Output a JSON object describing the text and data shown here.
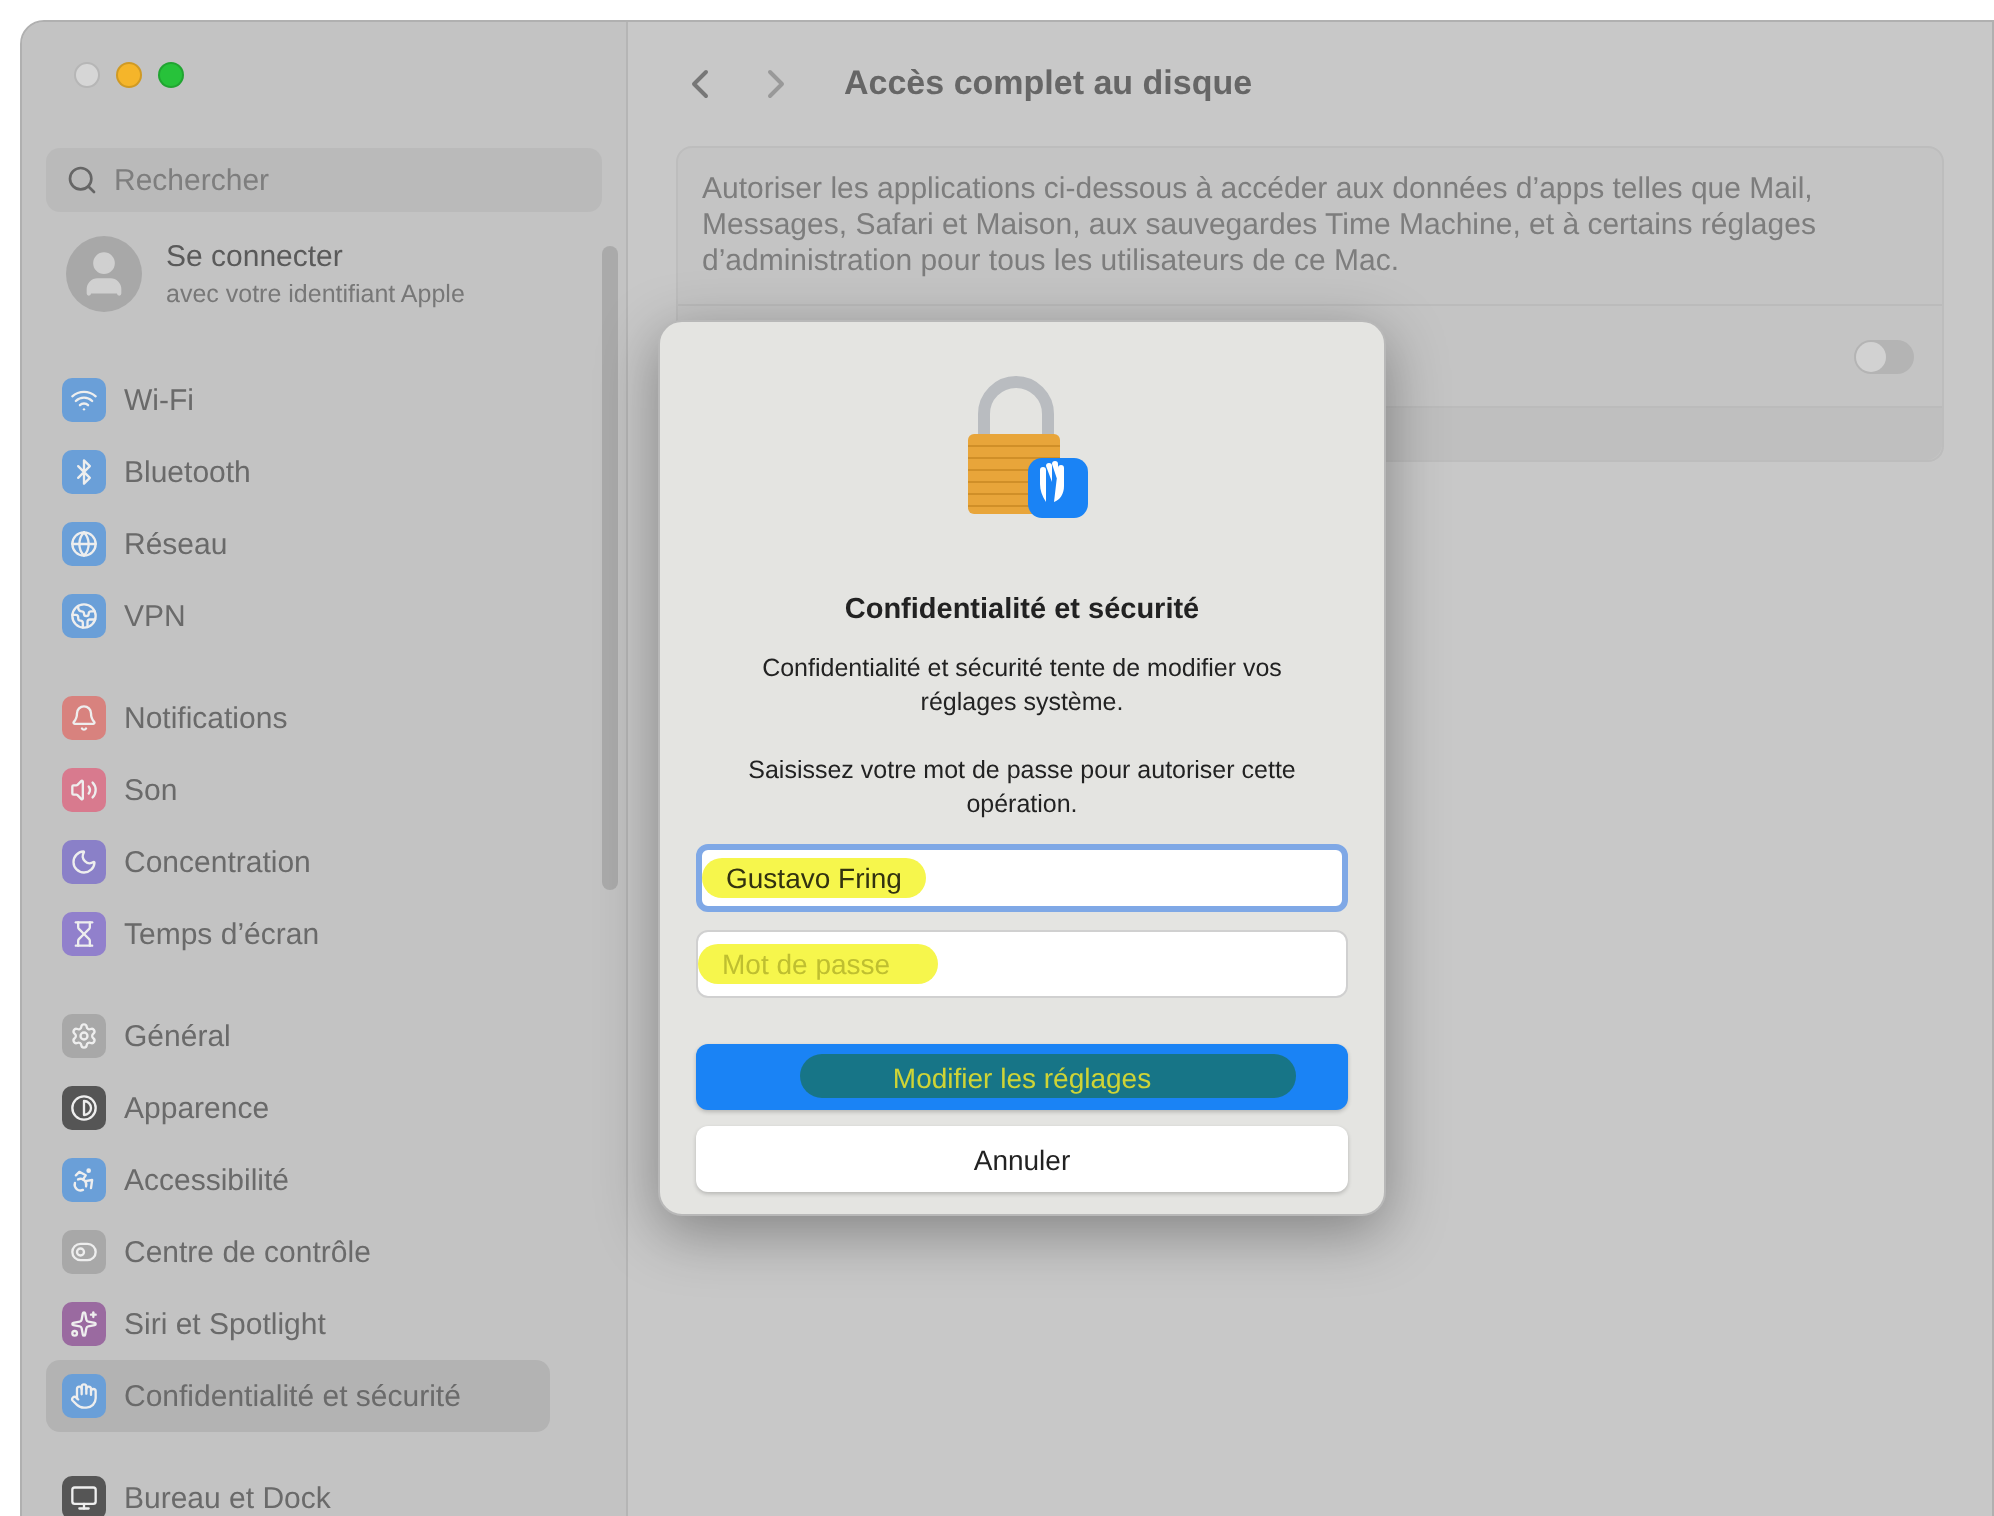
{
  "window": {
    "title": "Accès complet au disque"
  },
  "sidebar": {
    "search": {
      "placeholder": "Rechercher"
    },
    "account": {
      "title": "Se connecter",
      "subtitle": "avec votre identifiant Apple"
    },
    "groups": [
      {
        "items": [
          {
            "label": "Wi-Fi",
            "color": "#6a9fd8",
            "selected": false
          },
          {
            "label": "Bluetooth",
            "color": "#6a9fd8",
            "selected": false
          },
          {
            "label": "Réseau",
            "color": "#6a9fd8",
            "selected": false
          },
          {
            "label": "VPN",
            "color": "#6a9fd8",
            "selected": false
          }
        ]
      },
      {
        "items": [
          {
            "label": "Notifications",
            "color": "#d8827e",
            "selected": false
          },
          {
            "label": "Son",
            "color": "#d87a8e",
            "selected": false
          },
          {
            "label": "Concentration",
            "color": "#8a80c8",
            "selected": false
          },
          {
            "label": "Temps d’écran",
            "color": "#9180cc",
            "selected": false
          }
        ]
      },
      {
        "items": [
          {
            "label": "Général",
            "color": "#a8a8a8",
            "selected": false
          },
          {
            "label": "Apparence",
            "color": "#555555",
            "selected": false
          },
          {
            "label": "Accessibilité",
            "color": "#6a9fd8",
            "selected": false
          },
          {
            "label": "Centre de contrôle",
            "color": "#a8a8a8",
            "selected": false
          },
          {
            "label": "Siri et Spotlight",
            "color": "#9a6aa0",
            "selected": false
          },
          {
            "label": "Confidentialité et sécurité",
            "color": "#6a9fd8",
            "selected": true
          }
        ]
      },
      {
        "items": [
          {
            "label": "Bureau et Dock",
            "color": "#555555",
            "selected": false
          }
        ]
      }
    ]
  },
  "main": {
    "description": "Autoriser les applications ci-dessous à accéder aux données d’apps telles que Mail, Messages, Safari et Maison, aux sauvegardes Time Machine, et à certains réglages d’administration pour tous les utilisateurs de ce Mac.",
    "toggle": {
      "on": false
    }
  },
  "dialog": {
    "title": "Confidentialité et sécurité",
    "message": "Confidentialité et sécurité tente de modifier vos réglages système.",
    "prompt": "Saisissez votre mot de passe pour autoriser cette opération.",
    "username": {
      "value": "Gustavo Fring",
      "focused": true
    },
    "password": {
      "placeholder": "Mot de passe"
    },
    "buttons": [
      {
        "label": "Modifier les réglages",
        "kind": "primary"
      },
      {
        "label": "Annuler",
        "kind": "secondary"
      }
    ]
  }
}
